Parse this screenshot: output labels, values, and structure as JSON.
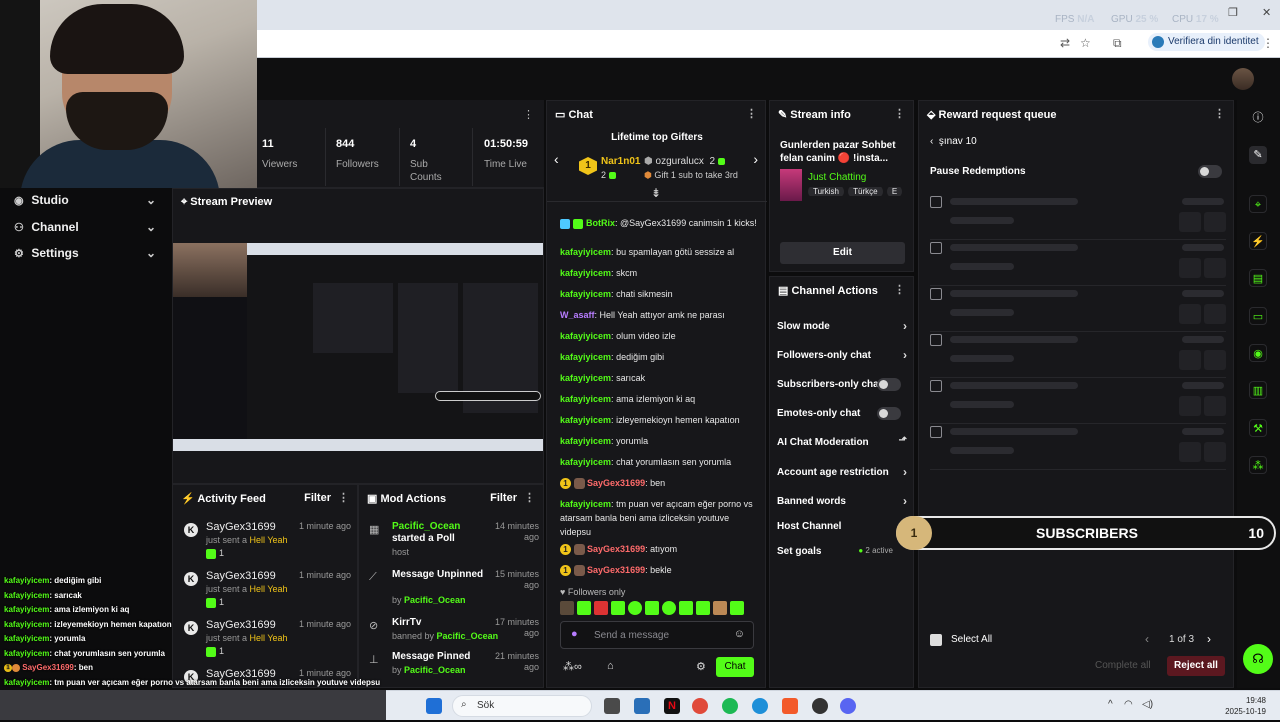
{
  "browser": {
    "perf": {
      "fps_label": "FPS",
      "fps": "N/A",
      "gpu_label": "GPU",
      "gpu": "25 %",
      "cpu_label": "CPU",
      "cpu": "17 %"
    },
    "verify_label": "Verifiera din identitet"
  },
  "nav": {
    "items": [
      {
        "label": "Studio"
      },
      {
        "label": "Channel"
      },
      {
        "label": "Settings"
      }
    ]
  },
  "stats": [
    {
      "value": "11",
      "label": "Viewers"
    },
    {
      "value": "844",
      "label": "Followers"
    },
    {
      "value": "4",
      "label": "Sub Counts"
    },
    {
      "value": "01:50:59",
      "label": "Time Live"
    }
  ],
  "preview": {
    "title": "Stream Preview"
  },
  "activity": {
    "title": "Activity Feed",
    "filter": "Filter",
    "items": [
      {
        "name": "SayGex31699",
        "time": "1 minute ago",
        "desc": "just sent a ",
        "gift": "Hell Yeah",
        "count": "1"
      },
      {
        "name": "SayGex31699",
        "time": "1 minute ago",
        "desc": "just sent a ",
        "gift": "Hell Yeah",
        "count": "1"
      },
      {
        "name": "SayGex31699",
        "time": "1 minute ago",
        "desc": "just sent a ",
        "gift": "Hell Yeah",
        "count": "1"
      },
      {
        "name": "SayGex31699",
        "time": "1 minute ago",
        "desc": "",
        "gift": "",
        "count": ""
      }
    ]
  },
  "mod": {
    "title": "Mod Actions",
    "filter": "Filter",
    "items": [
      {
        "line1": "Pacific_Ocean",
        "line1b": "started a Poll",
        "line2": "host",
        "by": "",
        "time": "14 minutes ago"
      },
      {
        "line1": "Message Unpinned",
        "line1b": "",
        "line2": "by ",
        "by": "Pacific_Ocean",
        "time": "15 minutes ago"
      },
      {
        "line1": "KirrTv",
        "line1b": "",
        "line2": "banned by ",
        "by": "Pacific_Ocean",
        "time": "17 minutes ago"
      },
      {
        "line1": "Message Pinned",
        "line1b": "",
        "line2": "by ",
        "by": "Pacific_Ocean",
        "time": "21 minutes ago"
      }
    ]
  },
  "chat": {
    "title": "Chat",
    "gifters_title": "Lifetime top Gifters",
    "gifter1": {
      "name": "Nar1n01",
      "count": "2"
    },
    "gifter2": {
      "name": "ozguralucx",
      "count": "2"
    },
    "gift_hint": "Gift 1 sub to take 3rd",
    "messages": [
      {
        "user": "BotRix",
        "text": " @SayGex31699 canimsin 1 kicks!",
        "color": "u-g"
      },
      {
        "user": "kafayiyicem",
        "text": " bu spamlayan götü sessize al",
        "color": "u-g"
      },
      {
        "user": "kafayiyicem",
        "text": " skcm",
        "color": "u-g"
      },
      {
        "user": "kafayiyicem",
        "text": " chati sikmesin",
        "color": "u-g"
      },
      {
        "user": "W_asaff",
        "text": " Hell Yeah attıyor amk ne parası",
        "color": "u-p"
      },
      {
        "user": "kafayiyicem",
        "text": " olum video izle",
        "color": "u-g"
      },
      {
        "user": "kafayiyicem",
        "text": " dediğim gibi",
        "color": "u-g"
      },
      {
        "user": "kafayiyicem",
        "text": " sarıcak",
        "color": "u-g"
      },
      {
        "user": "kafayiyicem",
        "text": " ama izlemiyon ki aq",
        "color": "u-g"
      },
      {
        "user": "kafayiyicem",
        "text": " izleyemekioyn hemen kapatıon",
        "color": "u-g"
      },
      {
        "user": "kafayiyicem",
        "text": " yorumla",
        "color": "u-g"
      },
      {
        "user": "kafayiyicem",
        "text": " chat yorumlasın sen yorumla",
        "color": "u-g"
      },
      {
        "user": "SayGex31699",
        "text": " ben",
        "color": "u-r"
      },
      {
        "user": "kafayiyicem",
        "text": " tm puan ver açıcam eğer porno vs atarsam banla beni ama izliceksin youtuve videpsu",
        "color": "u-g"
      },
      {
        "user": "SayGex31699",
        "text": " atıyom",
        "color": "u-r"
      },
      {
        "user": "SayGex31699",
        "text": " bekle",
        "color": "u-r"
      }
    ],
    "followers_only": "Followers only",
    "placeholder": "Send a message",
    "send": "Chat"
  },
  "streaminfo": {
    "title": "Stream info",
    "stream_title": "Gunlerden pazar Sohbet felan canim 🔴 !insta...",
    "category": "Just Chatting",
    "tags": [
      "Turkish",
      "Türkçe",
      "E"
    ],
    "edit": "Edit"
  },
  "actions": {
    "title": "Channel Actions",
    "items": [
      {
        "label": "Slow mode",
        "kind": "arrow"
      },
      {
        "label": "Followers-only chat",
        "kind": "arrow"
      },
      {
        "label": "Subscribers-only chat",
        "kind": "toggle"
      },
      {
        "label": "Emotes-only chat",
        "kind": "toggle"
      },
      {
        "label": "AI Chat Moderation",
        "kind": "ext"
      },
      {
        "label": "Account age restriction",
        "kind": "arrow"
      },
      {
        "label": "Banned words",
        "kind": "arrow"
      },
      {
        "label": "Host Channel",
        "kind": "none"
      },
      {
        "label": "Set goals",
        "kind": "goals"
      }
    ],
    "goals_active": "2 active"
  },
  "reward": {
    "title": "Reward request queue",
    "back_label": "şınav 10",
    "pause": "Pause Redemptions",
    "select_all": "Select All",
    "page": "1 of 3",
    "complete_all": "Complete all",
    "reject_all": "Reject all"
  },
  "subs_overlay": {
    "rank": "1",
    "label": "SUBSCRIBERS",
    "value": "10"
  },
  "overlay_chat": [
    {
      "user": "kafayiyicem",
      "text": " dediğim gibi"
    },
    {
      "user": "kafayiyicem",
      "text": " sarıcak"
    },
    {
      "user": "kafayiyicem",
      "text": " ama izlemiyon ki aq"
    },
    {
      "user": "kafayiyicem",
      "text": " izleyemekioyn hemen kapatıon"
    },
    {
      "user": "kafayiyicem",
      "text": " yorumla"
    },
    {
      "user": "kafayiyicem",
      "text": " chat yorumlasın sen yorumla"
    },
    {
      "user": "SayGex31699",
      "text": " ben"
    },
    {
      "user": "kafayiyicem",
      "text": " tm puan ver açıcam eğer porno vs atarsam banla beni ama izliceksin youtuve videpsu"
    },
    {
      "user": "SayGex31699",
      "text": " atıyom"
    },
    {
      "user": "SayGex31699",
      "text": " bekle"
    }
  ],
  "taskbar": {
    "search": "Sök",
    "time": "19:48",
    "date": "2025-10-19"
  },
  "colors": {
    "accent": "#53fc18",
    "panel": "#17171a",
    "reject": "#5c1820"
  }
}
